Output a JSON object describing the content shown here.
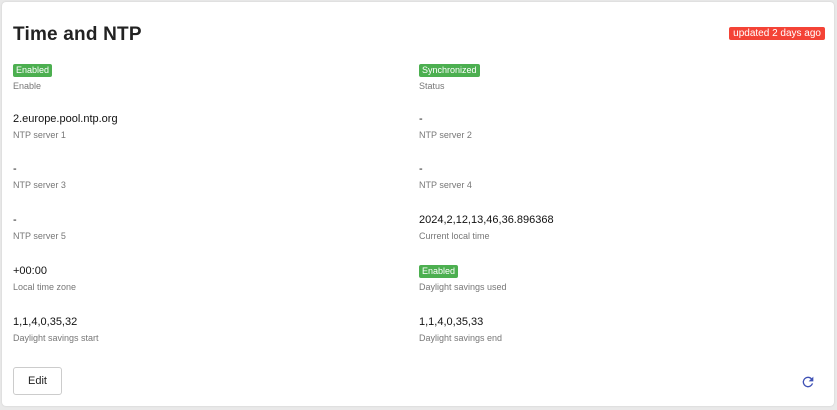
{
  "header": {
    "title": "Time and NTP",
    "updated_badge": "updated 2 days ago"
  },
  "fields": {
    "enable": {
      "value": "Enabled",
      "label": "Enable"
    },
    "status": {
      "value": "Synchronized",
      "label": "Status"
    },
    "ntp1": {
      "value": "2.europe.pool.ntp.org",
      "label": "NTP server 1"
    },
    "ntp2": {
      "value": "-",
      "label": "NTP server 2"
    },
    "ntp3": {
      "value": "-",
      "label": "NTP server 3"
    },
    "ntp4": {
      "value": "-",
      "label": "NTP server 4"
    },
    "ntp5": {
      "value": "-",
      "label": "NTP server 5"
    },
    "local_time": {
      "value": "2024,2,12,13,46,36.896368",
      "label": "Current local time"
    },
    "tz": {
      "value": "+00:00",
      "label": "Local time zone"
    },
    "dst_used": {
      "value": "Enabled",
      "label": "Daylight savings used"
    },
    "dst_start": {
      "value": "1,1,4,0,35,32",
      "label": "Daylight savings start"
    },
    "dst_end": {
      "value": "1,1,4,0,35,33",
      "label": "Daylight savings end"
    }
  },
  "actions": {
    "edit_label": "Edit",
    "refresh_icon": "refresh-icon"
  },
  "colors": {
    "badge_green": "#4caf50",
    "badge_red": "#f44336",
    "refresh_blue": "#3f51b5"
  }
}
